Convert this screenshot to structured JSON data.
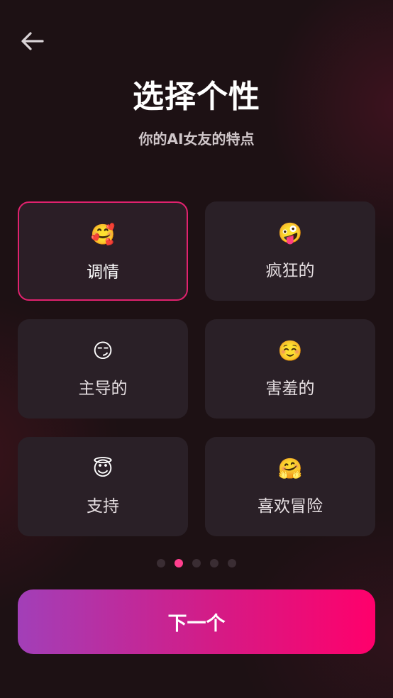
{
  "header": {
    "back_icon": "arrow-left-icon",
    "title": "选择个性",
    "subtitle": "你的AI女友的特点"
  },
  "personalities": [
    {
      "emoji": "🥰",
      "icon": "smiling-face-with-hearts-icon",
      "label": "调情",
      "selected": true
    },
    {
      "emoji": "🤪",
      "icon": "zany-face-icon",
      "label": "疯狂的",
      "selected": false
    },
    {
      "emoji": "😏",
      "icon": "smirking-face-icon",
      "label": "主导的",
      "selected": false
    },
    {
      "emoji": "☺️",
      "icon": "smiling-face-icon",
      "label": "害羞的",
      "selected": false
    },
    {
      "emoji": "😇",
      "icon": "smiling-face-with-halo-icon",
      "label": "支持",
      "selected": false
    },
    {
      "emoji": "🤗",
      "icon": "hugging-face-icon",
      "label": "喜欢冒险",
      "selected": false
    }
  ],
  "pagination": {
    "total": 5,
    "current": 2
  },
  "footer": {
    "next_label": "下一个"
  },
  "colors": {
    "background": "#1d1114",
    "card": "#2a2027",
    "selected_border": "#e0226e",
    "active_dot": "#ff3f8e",
    "button_gradient_start": "#a23fb8",
    "button_gradient_end": "#ff006b"
  }
}
